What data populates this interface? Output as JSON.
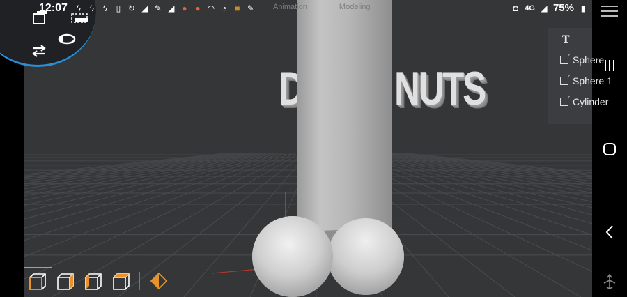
{
  "status_bar": {
    "time": "12:07",
    "battery": "75%",
    "network": "4G",
    "left_icons": [
      "bolt-icon",
      "bolt-icon",
      "bolt-icon",
      "phone-icon",
      "signal-hook-icon",
      "mountain-icon",
      "wrench-icon",
      "mountain-icon",
      "app-badge-icon",
      "app-badge-icon",
      "wifi-icon",
      "gauge-icon",
      "app-badge-icon",
      "wrench-icon"
    ]
  },
  "mode_tabs": [
    "Animation",
    "Modeling"
  ],
  "hierarchy": {
    "items": [
      {
        "icon": "text-object-icon",
        "label": ""
      },
      {
        "icon": "cube-object-icon",
        "label": "Sphere"
      },
      {
        "icon": "cube-object-icon",
        "label": "Sphere 1"
      },
      {
        "icon": "cube-object-icon",
        "label": "Cylinder"
      }
    ]
  },
  "scene": {
    "text_left": "D",
    "text_right": "NUTS"
  },
  "bottom_toolbar": {
    "views": [
      "view-front-icon",
      "view-right-icon",
      "view-left-icon",
      "view-top-icon"
    ],
    "keyframe": "keyframe-icon"
  },
  "colors": {
    "viewport_bg": "#343638",
    "accent_orange": "#e6922d",
    "accent_blue": "#2a8fd6",
    "axis_green": "#2fa84a",
    "axis_red": "#c0392b"
  }
}
